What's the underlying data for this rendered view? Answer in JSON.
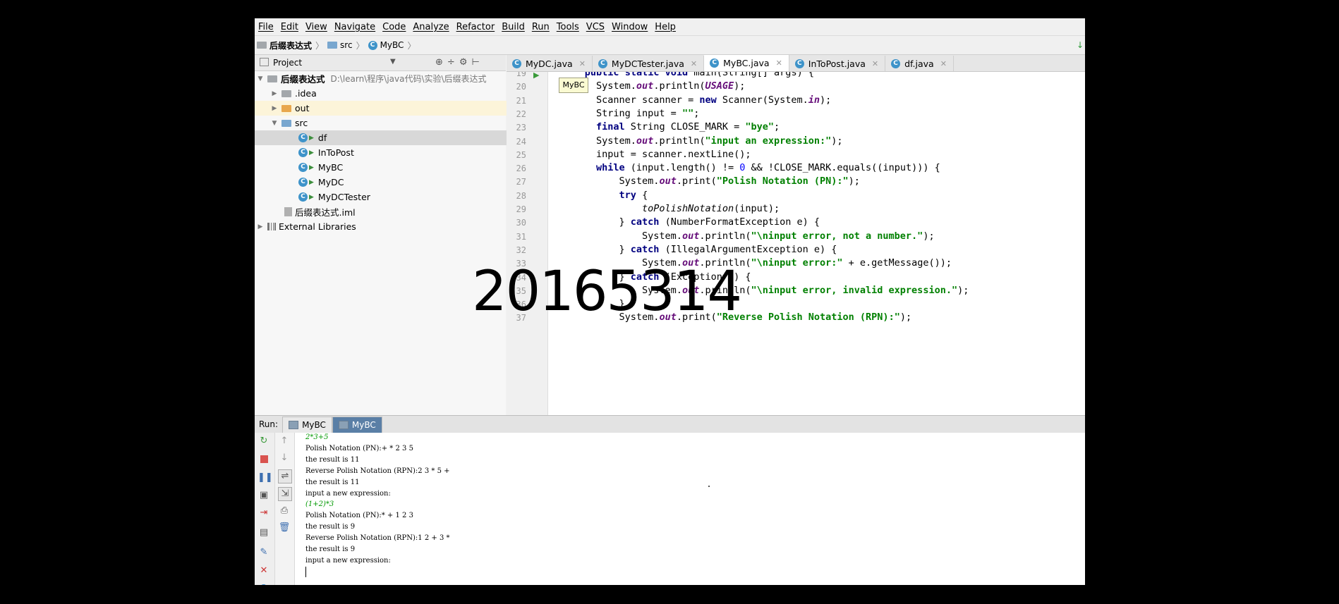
{
  "menu": [
    "File",
    "Edit",
    "View",
    "Navigate",
    "Code",
    "Analyze",
    "Refactor",
    "Build",
    "Run",
    "Tools",
    "VCS",
    "Window",
    "Help"
  ],
  "breadcrumb": [
    "后缀表达式",
    "src",
    "MyBC"
  ],
  "project": {
    "title": "Project",
    "tree": [
      {
        "label": "后缀表达式",
        "path": "D:\\learn\\程序\\java代码\\实验\\后缀表达式"
      },
      {
        "label": ".idea"
      },
      {
        "label": "out"
      },
      {
        "label": "src"
      },
      {
        "label": "df"
      },
      {
        "label": "InToPost"
      },
      {
        "label": "MyBC"
      },
      {
        "label": "MyDC"
      },
      {
        "label": "MyDCTester"
      },
      {
        "label": "后缀表达式.iml"
      },
      {
        "label": "External Libraries"
      }
    ]
  },
  "tabs": [
    {
      "label": "MyDC.java"
    },
    {
      "label": "MyDCTester.java"
    },
    {
      "label": "MyBC.java"
    },
    {
      "label": "InToPost.java"
    },
    {
      "label": "df.java"
    }
  ],
  "tooltip": "MyBC",
  "editor": {
    "line_numbers": [
      "19",
      "20",
      "21",
      "22",
      "23",
      "24",
      "25",
      "26",
      "27",
      "28",
      "29",
      "30",
      "31",
      "32",
      "33",
      "34",
      "35",
      "36",
      "37"
    ]
  },
  "run": {
    "label": "Run:",
    "tabs": [
      "MyBC",
      "MyBC"
    ],
    "console": [
      {
        "text": "2*3+5",
        "type": "input"
      },
      {
        "text": "Polish Notation (PN):+ * 2 3 5",
        "type": "out"
      },
      {
        "text": "the result is 11",
        "type": "out"
      },
      {
        "text": "Reverse Polish Notation (RPN):2 3 * 5 +",
        "type": "out"
      },
      {
        "text": "the result is 11",
        "type": "out"
      },
      {
        "text": "input a new expression:",
        "type": "out"
      },
      {
        "text": "(1+2)*3",
        "type": "input"
      },
      {
        "text": "Polish Notation (PN):* + 1 2 3",
        "type": "out"
      },
      {
        "text": "the result is 9",
        "type": "out"
      },
      {
        "text": "Reverse Polish Notation (RPN):1 2 + 3 *",
        "type": "out"
      },
      {
        "text": "the result is 9",
        "type": "out"
      },
      {
        "text": "input a new expression:",
        "type": "out"
      }
    ]
  },
  "watermark": "20165314"
}
